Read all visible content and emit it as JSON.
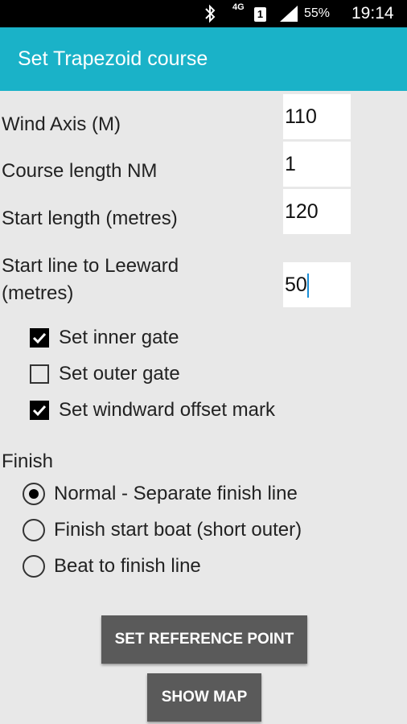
{
  "status_bar": {
    "network_type": "4G",
    "sim_slot": "1",
    "battery_percent": "55%",
    "time": "19:14",
    "icons": [
      "bluetooth-icon",
      "signal-icon",
      "battery-charging-icon"
    ]
  },
  "app_bar": {
    "title": "Set Trapezoid course",
    "color": "#1ab2c8"
  },
  "fields": [
    {
      "label": "Wind Axis (M)",
      "value": "110"
    },
    {
      "label": "Course length NM",
      "value": "1"
    },
    {
      "label": "Start length (metres)",
      "value": "120"
    },
    {
      "label_line1": "Start line to Leeward",
      "label_line2": "(metres)",
      "value": "50"
    }
  ],
  "checkboxes": [
    {
      "label": "Set inner gate",
      "checked": true
    },
    {
      "label": "Set outer gate",
      "checked": false
    },
    {
      "label": "Set windward offset mark",
      "checked": true
    }
  ],
  "finish": {
    "heading": "Finish",
    "options": [
      {
        "label": "Normal - Separate finish line",
        "selected": true
      },
      {
        "label": "Finish start boat (short outer)",
        "selected": false
      },
      {
        "label": "Beat to finish line",
        "selected": false
      }
    ]
  },
  "buttons": {
    "set_reference_point": "SET REFERENCE POINT",
    "show_map": "SHOW MAP"
  }
}
